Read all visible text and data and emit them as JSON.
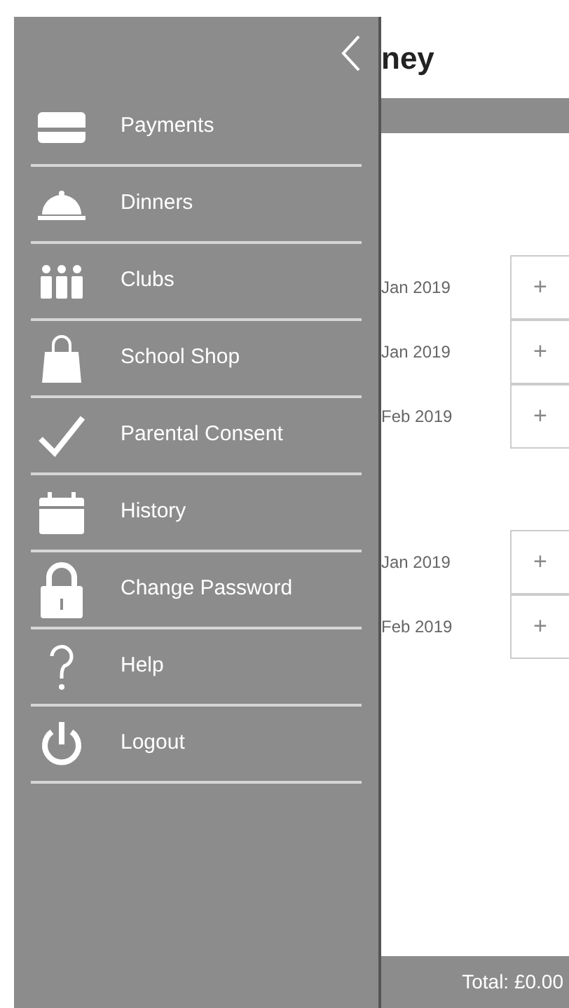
{
  "drawer": {
    "items": [
      {
        "label": "Payments"
      },
      {
        "label": "Dinners"
      },
      {
        "label": "Clubs"
      },
      {
        "label": "School Shop"
      },
      {
        "label": "Parental Consent"
      },
      {
        "label": "History"
      },
      {
        "label": "Change Password"
      },
      {
        "label": "Help"
      },
      {
        "label": "Logout"
      }
    ]
  },
  "page": {
    "title": "ney",
    "groups": [
      {
        "rows": [
          {
            "date": "Jan 2019",
            "action": "+"
          },
          {
            "date": "Jan 2019",
            "action": "+"
          },
          {
            "date": "Feb 2019",
            "action": "+"
          }
        ]
      },
      {
        "rows": [
          {
            "date": "Jan 2019",
            "action": "+"
          },
          {
            "date": "Feb 2019",
            "action": "+"
          }
        ]
      }
    ],
    "total": "Total: £0.00"
  }
}
